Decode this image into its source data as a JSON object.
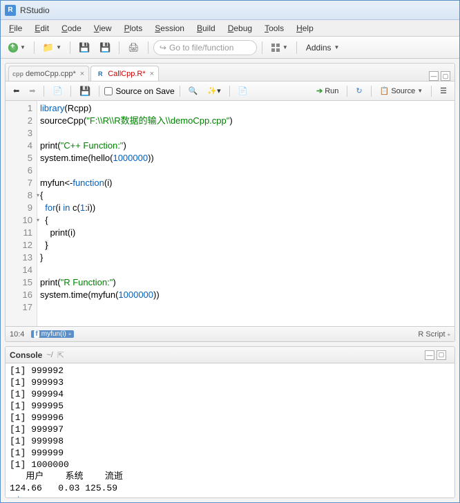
{
  "window": {
    "title": "RStudio"
  },
  "menubar": [
    "File",
    "Edit",
    "Code",
    "View",
    "Plots",
    "Session",
    "Build",
    "Debug",
    "Tools",
    "Help"
  ],
  "toolbar": {
    "goto_placeholder": "Go to file/function",
    "addins": "Addins"
  },
  "tabs": [
    {
      "label": "demoCpp.cpp*",
      "icon": "cpp",
      "active": false
    },
    {
      "label": "CallCpp.R*",
      "icon": "R",
      "active": true
    }
  ],
  "editor_toolbar": {
    "source_on_save": "Source on Save",
    "run": "Run",
    "source": "Source"
  },
  "code_lines": [
    {
      "n": "1",
      "html": "<span class='kw'>library</span>(Rcpp)"
    },
    {
      "n": "2",
      "html": "sourceCpp(<span class='str'>\"F:\\\\R\\\\R数据的输入\\\\demoCpp.cpp\"</span>)"
    },
    {
      "n": "3",
      "html": ""
    },
    {
      "n": "4",
      "html": "print(<span class='str'>\"C++ Function:\"</span>)"
    },
    {
      "n": "5",
      "html": "system.time(hello(<span class='num'>1000000</span>))"
    },
    {
      "n": "6",
      "html": ""
    },
    {
      "n": "7",
      "html": "myfun&lt;-<span class='kw'>function</span>(i)"
    },
    {
      "n": "8",
      "html": "{",
      "fold": true
    },
    {
      "n": "9",
      "html": "  <span class='kw'>for</span>(i <span class='kw'>in</span> c(<span class='num'>1</span>:i))"
    },
    {
      "n": "10",
      "html": "  {",
      "fold": true
    },
    {
      "n": "11",
      "html": "    print(i)"
    },
    {
      "n": "12",
      "html": "  <span style='background:#eee'>}</span>"
    },
    {
      "n": "13",
      "html": "}"
    },
    {
      "n": "14",
      "html": ""
    },
    {
      "n": "15",
      "html": "print(<span class='str'>\"R Function:\"</span>)"
    },
    {
      "n": "16",
      "html": "system.time(myfun(<span class='num'>1000000</span>))"
    },
    {
      "n": "17",
      "html": ""
    }
  ],
  "statusbar": {
    "cursor": "10:4",
    "fn": "myfun(i)",
    "lang": "R Script"
  },
  "console": {
    "tab": "Console",
    "path": "~/",
    "lines": [
      "[1] 999992",
      "[1] 999993",
      "[1] 999994",
      "[1] 999995",
      "[1] 999996",
      "[1] 999997",
      "[1] 999998",
      "[1] 999999",
      "[1] 1000000",
      "   用户    系统    流逝",
      "124.66   0.03 125.59"
    ],
    "prompt": "> i"
  }
}
